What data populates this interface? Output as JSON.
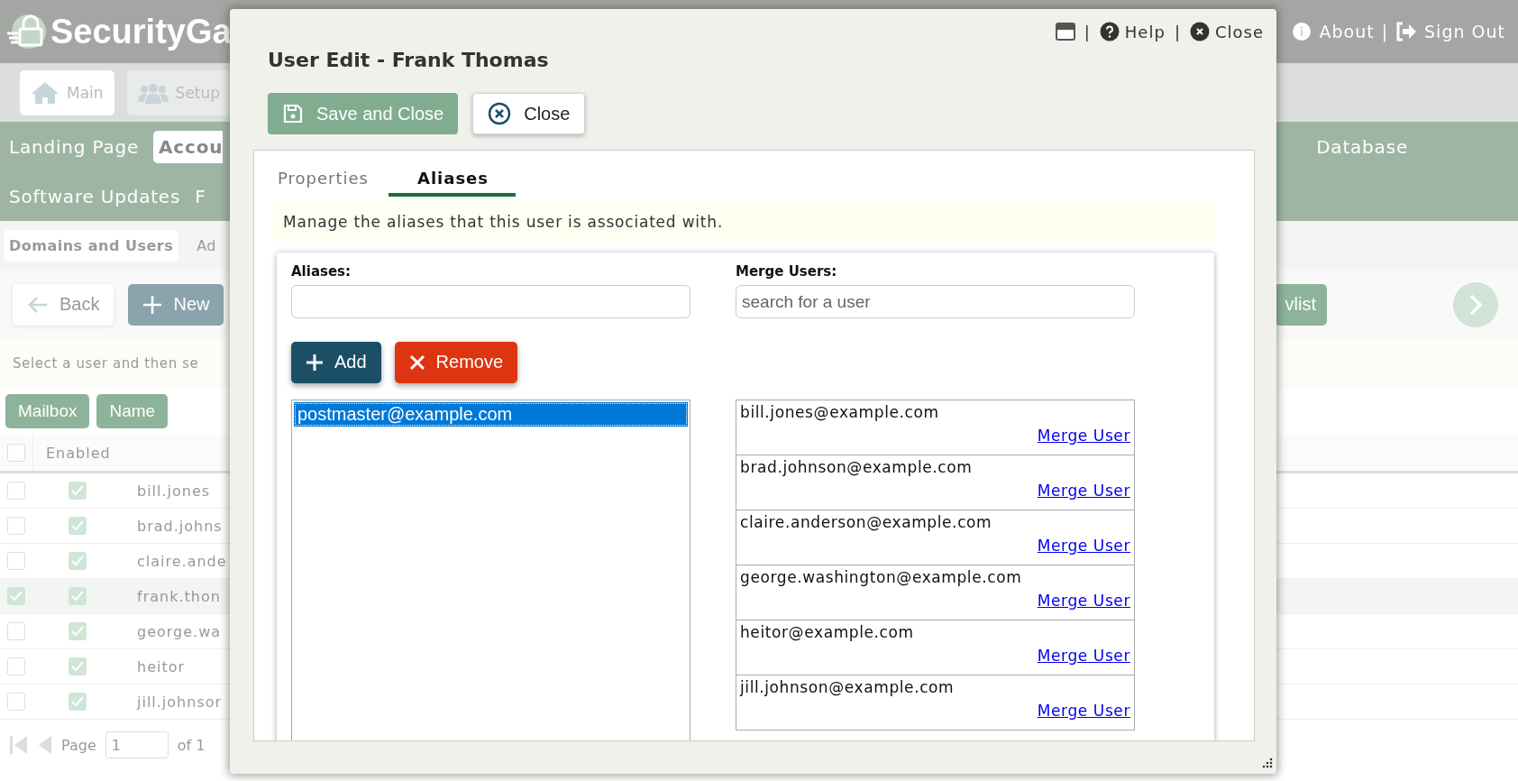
{
  "background_app": {
    "logo_text": "SecurityGa",
    "header_links": [
      {
        "kind": "info",
        "label": "About"
      },
      {
        "kind": "separator",
        "label": "|"
      },
      {
        "kind": "sign-out",
        "label": "Sign Out"
      }
    ],
    "nav_buttons": [
      {
        "kind": "home",
        "label": "Main"
      },
      {
        "kind": "users",
        "label": "Setup"
      }
    ],
    "menu_rows": [
      [
        {
          "label": "Landing Page",
          "selected": false
        },
        {
          "label": "Accou",
          "selected": true
        }
      ],
      [
        {
          "label": "Software Updates",
          "selected": false
        },
        {
          "label": "F",
          "selected": false
        }
      ]
    ],
    "menu_right": [
      "Database"
    ],
    "sub_tabs": [
      {
        "label": "Domains and Users",
        "selected": true
      },
      {
        "label": "Ad",
        "selected": false
      }
    ],
    "toolbar": [
      {
        "kind": "back",
        "label": "Back"
      },
      {
        "kind": "new",
        "label": "New"
      }
    ],
    "toolbar_right": "vlist",
    "hint": "Select a user and then se",
    "filters": [
      "Mailbox",
      "Name"
    ],
    "table": {
      "all_selected": false,
      "columns": [
        "Enabled"
      ],
      "rows": [
        {
          "selected": false,
          "enabled": true,
          "name": "bill.jones"
        },
        {
          "selected": false,
          "enabled": true,
          "name": "brad.johns"
        },
        {
          "selected": false,
          "enabled": true,
          "name": "claire.ande"
        },
        {
          "selected": true,
          "enabled": true,
          "name": "frank.thon"
        },
        {
          "selected": false,
          "enabled": true,
          "name": "george.wa"
        },
        {
          "selected": false,
          "enabled": true,
          "name": "heitor"
        },
        {
          "selected": false,
          "enabled": true,
          "name": "jill.johnsor"
        }
      ]
    },
    "pager": {
      "label": "Page",
      "value": "1",
      "total": "of 1"
    }
  },
  "dialog": {
    "title": "User Edit - Frank Thomas",
    "header_links": [
      {
        "kind": "window"
      },
      {
        "kind": "separator",
        "label": "|"
      },
      {
        "kind": "help",
        "label": "Help"
      },
      {
        "kind": "separator",
        "label": "|"
      },
      {
        "kind": "close",
        "label": "Close"
      }
    ],
    "buttons": [
      {
        "kind": "save",
        "label": "Save and Close"
      },
      {
        "kind": "close",
        "label": "Close"
      }
    ],
    "tabs": [
      {
        "label": "Properties",
        "selected": false
      },
      {
        "label": "Aliases",
        "selected": true
      }
    ],
    "description": "Manage the aliases that this user is associated with.",
    "aliases": {
      "label": "Aliases:",
      "items": [
        {
          "text": "postmaster@example.com",
          "selected": true
        }
      ]
    },
    "actions": [
      {
        "kind": "add",
        "label": "Add"
      },
      {
        "kind": "remove",
        "label": "Remove"
      }
    ],
    "merge": {
      "label": "Merge Users:",
      "placeholder": "search for a user",
      "users": [
        {
          "email": "bill.jones@example.com",
          "link": "Merge User"
        },
        {
          "email": "brad.johnson@example.com",
          "link": "Merge User"
        },
        {
          "email": "claire.anderson@example.com",
          "link": "Merge User"
        },
        {
          "email": "george.washington@example.com",
          "link": "Merge User"
        },
        {
          "email": "heitor@example.com",
          "link": "Merge User"
        },
        {
          "email": "jill.johnson@example.com",
          "link": "Merge User"
        }
      ]
    }
  }
}
